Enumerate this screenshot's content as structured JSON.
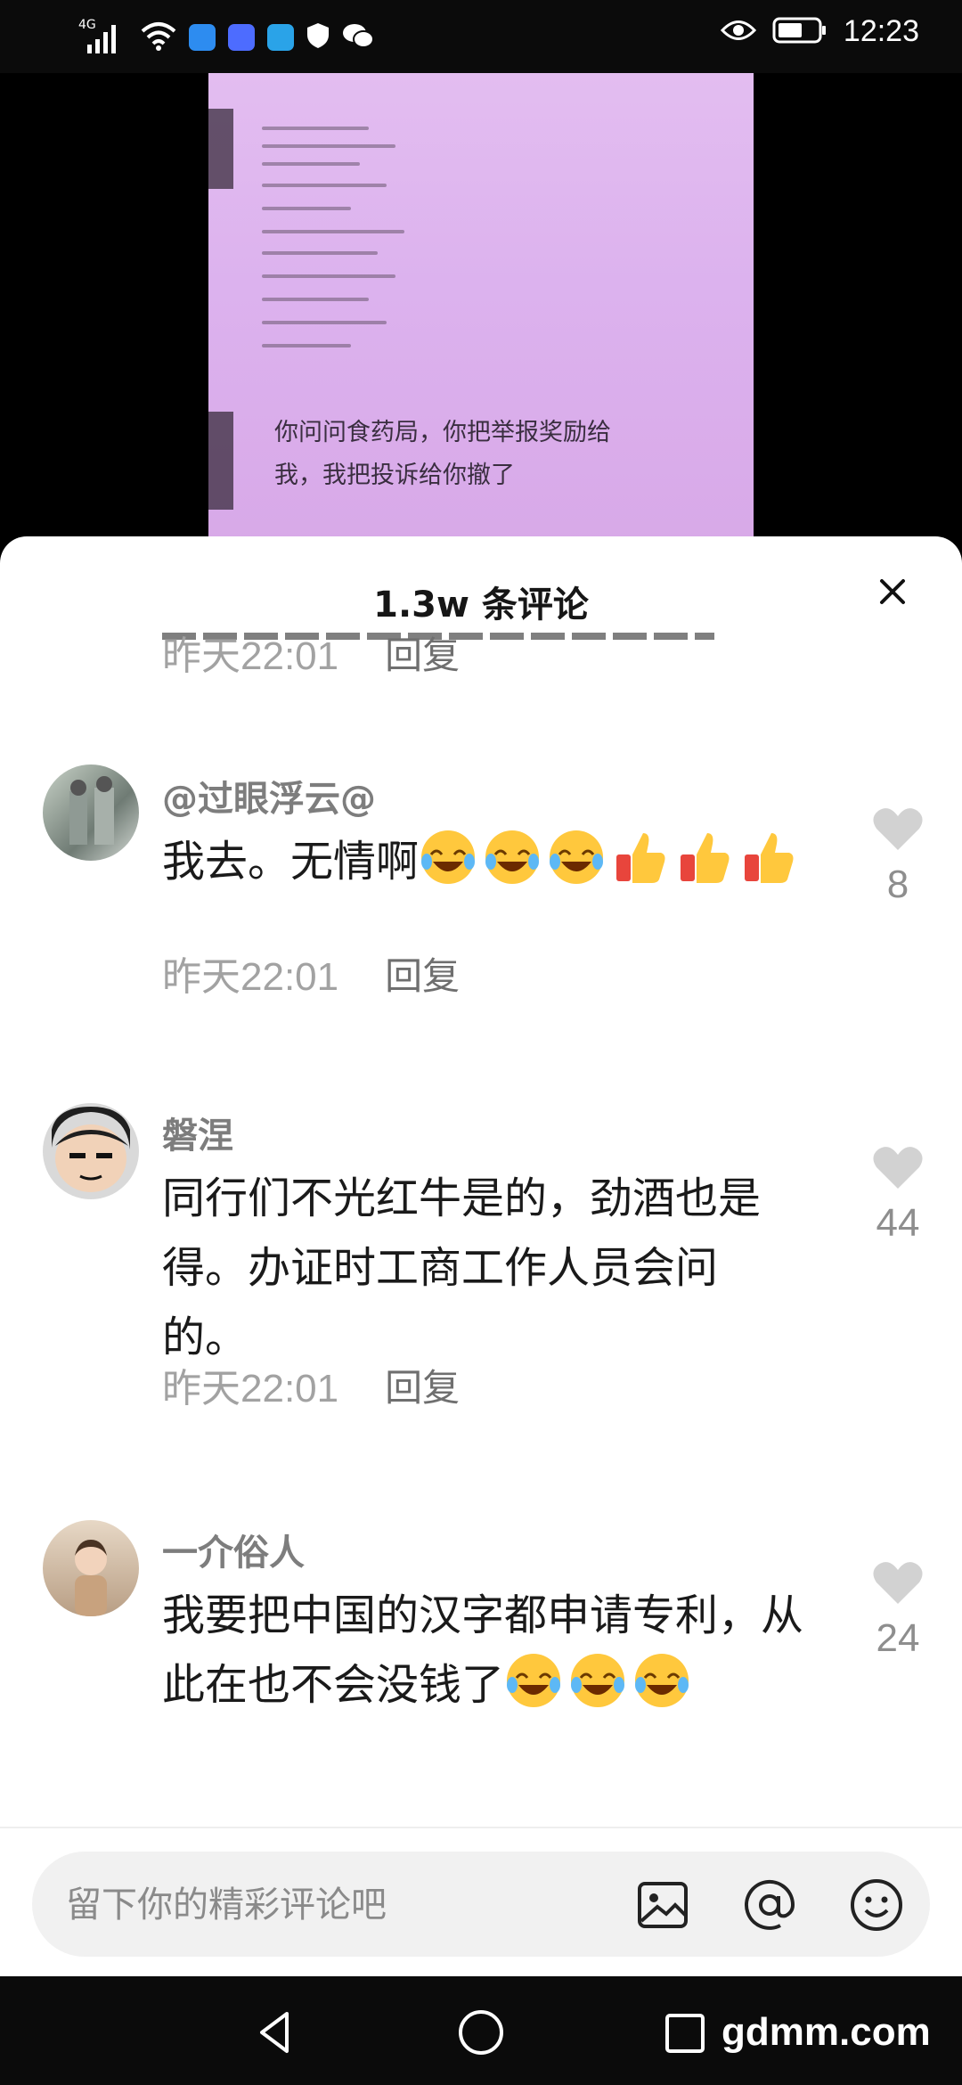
{
  "status_bar": {
    "network": "4G",
    "time": "12:23"
  },
  "video": {
    "caption": "你问问食药局，你把举报奖励给\n我，我把投诉给你撤了"
  },
  "sheet": {
    "title": "1.3w 条评论"
  },
  "partial_comment": {
    "time": "昨天22:01",
    "reply": "回复"
  },
  "comments": [
    {
      "username": "@过眼浮云@",
      "text": "我去。无情啊",
      "emojis": [
        "laughing-crying-emoji",
        "laughing-crying-emoji",
        "laughing-crying-emoji",
        "thumbs-up-emoji",
        "thumbs-up-emoji",
        "thumbs-up-emoji"
      ],
      "time": "昨天22:01",
      "reply": "回复",
      "likes": "8"
    },
    {
      "username": "磐涅",
      "text": "同行们不光红牛是的，劲酒也是得。办证时工商工作人员会问的。",
      "time": "昨天22:01",
      "reply": "回复",
      "likes": "44"
    },
    {
      "username": "一介俗人",
      "text": "我要把中国的汉字都申请专利，从此在也不会没钱了",
      "emojis": [
        "laughing-crying-emoji",
        "laughing-crying-emoji",
        "laughing-crying-emoji"
      ],
      "likes": "24"
    }
  ],
  "input": {
    "placeholder": "留下你的精彩评论吧"
  },
  "watermark": "gdmm.com",
  "colors": {
    "sheet_bg": "#ffffff",
    "input_bg": "#f1f1f1",
    "video_tint": "#dcb2ee",
    "muted_text": "#a2a2a2",
    "name_text": "#7d7d7d"
  }
}
